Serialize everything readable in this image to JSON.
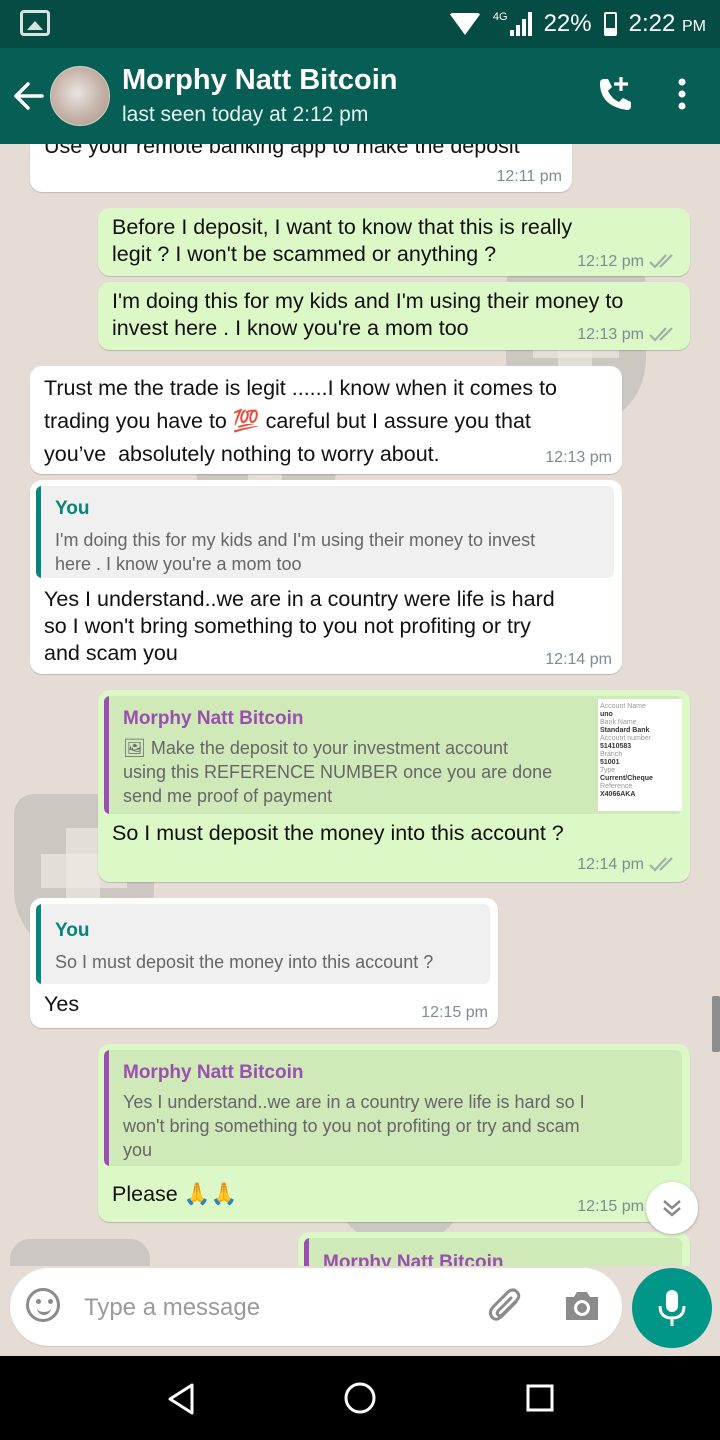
{
  "status_bar": {
    "network": "4G",
    "battery": "22%",
    "time": "2:22",
    "am_pm": "PM"
  },
  "header": {
    "contact_name": "Morphy Natt Bitcoin",
    "last_seen": "last seen today at 2:12 pm"
  },
  "messages": [
    {
      "text": "Use your remote banking app to make the deposit",
      "time": "12:11 pm"
    },
    {
      "text": "Before I deposit, I want to know that this is really\nlegit ? I won't be scammed or anything ?",
      "time": "12:12 pm"
    },
    {
      "text": "I'm doing this for my kids and I'm using their money to\ninvest here . I know you're a mom too",
      "time": "12:13 pm"
    },
    {
      "text": "Trust me the trade is legit ......I know when it comes to\ntrading you have to 💯 careful but I assure you that\nyou’ve  absolutely nothing to worry about.",
      "time": "12:13 pm"
    },
    {
      "quote_author": "You",
      "quote_text": "I'm doing this for my kids and I'm using their money to invest\nhere . I know you're a mom too",
      "text": "Yes I understand..we are in a country were life is hard\nso I won't bring something to you not profiting or try\nand scam you",
      "time": "12:14 pm"
    },
    {
      "quote_author": "Morphy Natt Bitcoin",
      "quote_text": "🖼 Make the deposit to your investment account\nusing this REFERENCE NUMBER once you are done\nsend me proof of payment",
      "text": "So I must deposit the money into this account ?",
      "time": "12:14 pm",
      "thumbnail_lines": [
        "Account Name",
        "uno",
        "Bank Name",
        "Standard Bank",
        "Account number",
        "51410583",
        "Branch",
        "51001",
        "Type",
        "Current/Cheque",
        "Reference",
        "X4066AKA"
      ]
    },
    {
      "quote_author": "You",
      "quote_text": "So I must deposit the money into this account ?",
      "text": "Yes",
      "time": "12:15 pm"
    },
    {
      "quote_author": "Morphy Natt Bitcoin",
      "quote_text": "Yes I understand..we are in a country were life is hard so I\nwon't bring something to you not profiting or try and scam\nyou",
      "text": "Please 🙏🙏",
      "time": "12:15 pm"
    },
    {
      "quote_author": "Morphy Natt Bitcoin"
    }
  ],
  "composer": {
    "placeholder": "Type a message"
  },
  "colors": {
    "header": "#075e54",
    "status_bar": "#054d44",
    "outgoing_bubble": "#dcf8c6",
    "incoming_bubble": "#ffffff",
    "accent": "#009688",
    "quote_you": "#06857a",
    "quote_contact": "#9b4fb0"
  }
}
